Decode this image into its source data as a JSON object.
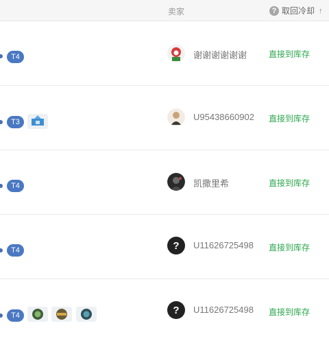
{
  "header": {
    "seller_label": "卖家",
    "cooldown_label": "取回冷却",
    "help_icon_glyph": "?",
    "sort_glyph": "↑"
  },
  "rows": [
    {
      "tier": "T4",
      "stickers": [],
      "seller": {
        "name": "谢谢谢谢谢谢",
        "avatar": "red-cartoon-avatar"
      },
      "action": "直接到库存"
    },
    {
      "tier": "T3",
      "stickers": [
        "blue-crest-sticker"
      ],
      "seller": {
        "name": "U95438660902",
        "avatar": "character-avatar"
      },
      "action": "直接到库存"
    },
    {
      "tier": "T4",
      "stickers": [],
      "seller": {
        "name": "凯撒里希",
        "avatar": "dark-portrait-avatar"
      },
      "action": "直接到库存"
    },
    {
      "tier": "T4",
      "stickers": [],
      "seller": {
        "name": "U11626725498",
        "avatar": "question-mark-avatar",
        "avatar_glyph": "?"
      },
      "action": "直接到库存"
    },
    {
      "tier": "T4",
      "stickers": [
        "green-team-sticker",
        "gold-team-sticker",
        "teal-team-sticker"
      ],
      "seller": {
        "name": "U11626725498",
        "avatar": "question-mark-avatar",
        "avatar_glyph": "?"
      },
      "action": "直接到库存"
    }
  ],
  "colors": {
    "tier_badge": "#4a78c2",
    "action_green": "#2fa84f",
    "header_bg": "#f6f6f6"
  }
}
